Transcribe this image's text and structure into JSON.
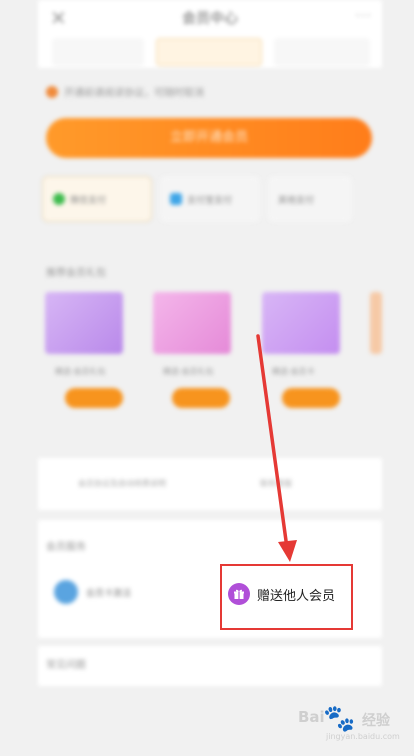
{
  "nav": {
    "title": "会员中心",
    "close_glyph": "✕",
    "more_glyph": "···"
  },
  "notice": {
    "text": "开通前请阅读协议，可随时取消"
  },
  "main_button": {
    "label": "立即开通会员"
  },
  "payment_options": [
    {
      "label": "微信支付",
      "icon_color": "#3dbb4d"
    },
    {
      "label": "支付宝支付",
      "icon_color": "#3fa6e8"
    },
    {
      "label": "其他支付"
    }
  ],
  "gift_section": {
    "title": "推荐会员礼包"
  },
  "gift_cards": [
    {
      "name": "精选·会员礼包"
    },
    {
      "name": "精选·会员礼包"
    },
    {
      "name": "精选·会员卡"
    }
  ],
  "links": {
    "left": "会员协议及自动续费说明",
    "right": "联系客服"
  },
  "services": {
    "title": "会员服务",
    "items": [
      {
        "label": "会员卡激活",
        "icon_color": "#5aa4e0"
      },
      {
        "label": "赠送他人会员",
        "icon_color": "#b04fd8",
        "icon": "gift-icon"
      }
    ]
  },
  "faq": {
    "title": "常见问题"
  },
  "annotation": {
    "color": "#e53935"
  },
  "watermark": {
    "brand": "Bai",
    "paw": "🐾",
    "cn": "经验",
    "url": "jingyan.baidu.com"
  }
}
